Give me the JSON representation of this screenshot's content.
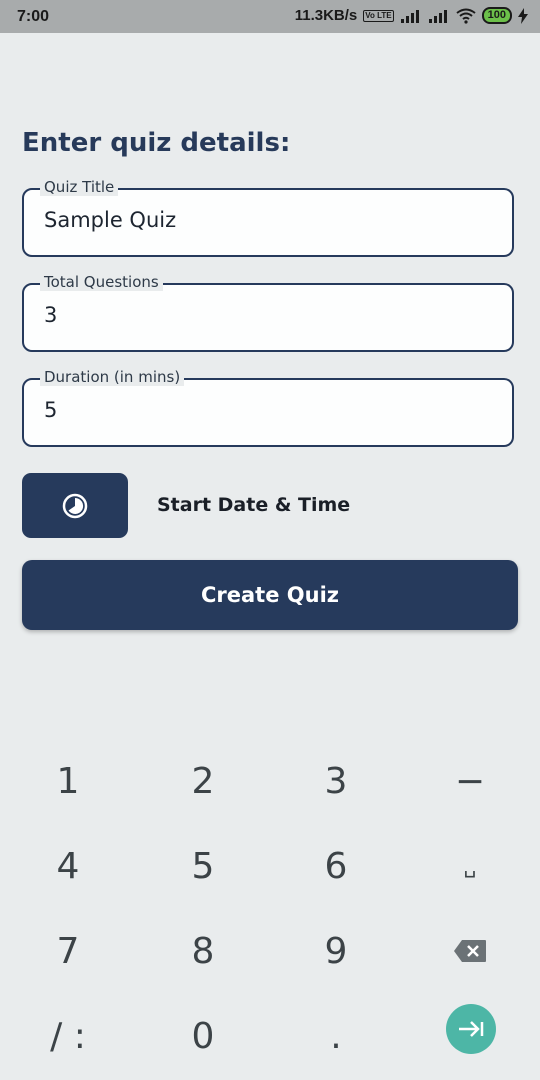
{
  "status_bar": {
    "time": "7:00",
    "network_speed": "11.3KB/s",
    "volte": "Vo LTE",
    "battery": "100",
    "icons": [
      "volte-icon",
      "signal-icon",
      "signal-icon",
      "wifi-icon",
      "battery-icon",
      "charging-icon"
    ]
  },
  "form": {
    "heading": "Enter quiz details:",
    "fields": [
      {
        "label": "Quiz Title",
        "value": "Sample Quiz"
      },
      {
        "label": "Total Questions",
        "value": "3"
      },
      {
        "label": "Duration (in mins)",
        "value": "5"
      }
    ],
    "time_button_icon": "clock-icon",
    "start_label": "Start Date & Time",
    "create_button": "Create Quiz"
  },
  "keypad": {
    "keys": [
      "1",
      "2",
      "3",
      "−",
      "4",
      "5",
      "6",
      "␣",
      "7",
      "8",
      "9",
      "⌫",
      "/ :",
      "0",
      ".",
      "⇥"
    ]
  },
  "colors": {
    "primary": "#263a5c",
    "background": "#e9eced",
    "enter_key": "#4db6a6",
    "status_bar": "#a8abac"
  }
}
